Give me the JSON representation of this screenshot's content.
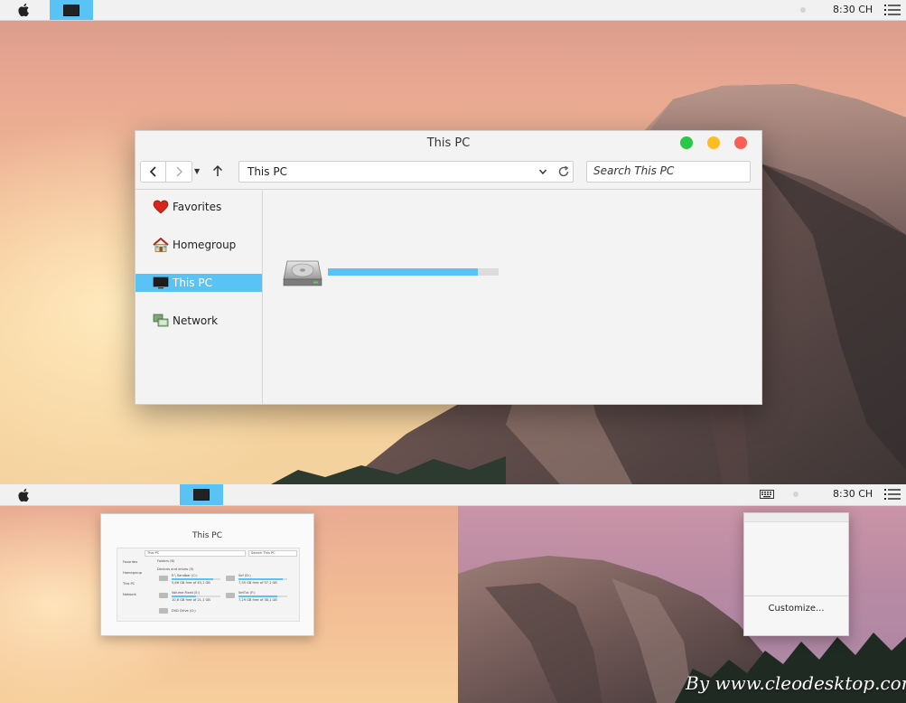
{
  "top_menubar": {
    "clock": "8:30 CH"
  },
  "explorer": {
    "title": "This PC",
    "address": "This PC",
    "search_placeholder": "Search This PC",
    "sidebar": [
      {
        "label": "Favorites",
        "icon": "heart-icon"
      },
      {
        "label": "Homegroup",
        "icon": "homegroup-icon"
      },
      {
        "label": "This PC",
        "icon": "monitor-icon",
        "active": true
      },
      {
        "label": "Network",
        "icon": "network-icon"
      }
    ],
    "drive_usage_fraction": 0.88
  },
  "bottom_menubar": {
    "clock": "8:30 CH"
  },
  "thumbnail": {
    "title": "This PC",
    "address": "This PC",
    "search": "Search This PC",
    "sidebar": [
      "Favorites",
      "Homegroup",
      "This PC",
      "Network"
    ],
    "folders_label": "Folders (6)",
    "devices_label": "Devices and drives (5)",
    "drives": [
      {
        "name": "E:\\ Sandbar (C:)",
        "free": "5,66 GB free of 40,1 GB",
        "usage": 0.85
      },
      {
        "name": "Sof (D:)",
        "free": "7,35 GB free of 97,1 GB",
        "usage": 0.9
      },
      {
        "name": "Volume Fixed (E:)",
        "free": "10,6 GB free of 21,1 GB",
        "usage": 0.5
      },
      {
        "name": "SetTxt (F:)",
        "free": "7,29 GB free of 38,1 GB",
        "usage": 0.8
      }
    ],
    "dvd_label": "DVD Drive (G:)"
  },
  "popup": {
    "customize_label": "Customize..."
  },
  "watermark": "By www.cleodesktop.com",
  "colors": {
    "accent": "#5ac3f5",
    "traffic_green": "#2ac84a",
    "traffic_yellow": "#fdbd22",
    "traffic_red": "#f95f56"
  }
}
